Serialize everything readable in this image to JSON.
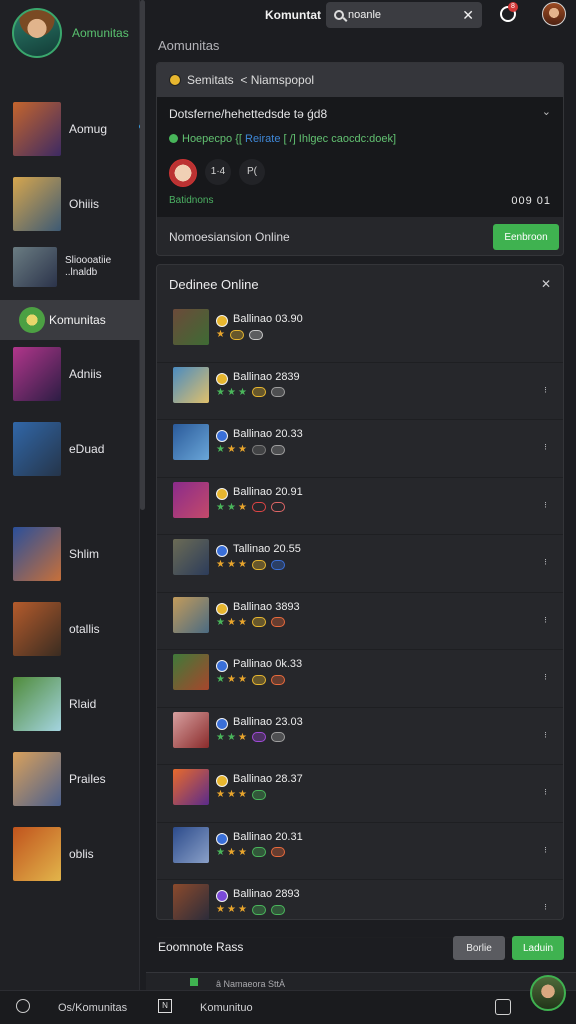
{
  "sidebar": {
    "title": "Aomunitas",
    "items": [
      {
        "label": "Aomug",
        "thumb": [
          "#c4652d",
          "#3d2a63"
        ]
      },
      {
        "label": "Ohiiis",
        "thumb": [
          "#d6a64e",
          "#3d5a74"
        ]
      },
      {
        "label": "Slioooatiie\n..lnaldb",
        "thumb": [
          "#6a7c82",
          "#2b334a"
        ]
      },
      {
        "label": "Komunitas",
        "thumb": [
          "#4ca043",
          "#e9d66b"
        ]
      },
      {
        "label": "Adniis",
        "thumb": [
          "#b1368b",
          "#2c1d44"
        ]
      },
      {
        "label": "eDuad",
        "thumb": [
          "#3167a8",
          "#25354a"
        ]
      },
      {
        "label": "Shlim",
        "thumb": [
          "#2a4f9a",
          "#c7703a"
        ]
      },
      {
        "label": "otallis",
        "thumb": [
          "#b45b2c",
          "#3a2c21"
        ]
      },
      {
        "label": "Rlaid",
        "thumb": [
          "#4f8b3a",
          "#a4d4e0"
        ]
      },
      {
        "label": "Prailes",
        "thumb": [
          "#d9a15c",
          "#4b5f8c"
        ]
      },
      {
        "label": "oblis",
        "thumb": [
          "#c0531d",
          "#e2b54b"
        ]
      }
    ]
  },
  "topbar": {
    "title": "Komuntat",
    "search_value": "noanle",
    "notification_count": "8"
  },
  "main": {
    "section_title": "Aomunitas",
    "post": {
      "header": "Semitats  < Niamspopol",
      "title": "Dotsferne/hehettedsde tǝ ǵd8",
      "sub_text": "Hoepecpo {[",
      "sub_link": "Reirate",
      "sub_after": "[ /] Ihlgec caocdc:doek]",
      "react_btn1": "1·4",
      "react_btn2": "P(",
      "foot_left": "Batidnons",
      "foot_right": "009 01",
      "status_text": "Nomoesiansion Online",
      "join_label": "Eenbroon"
    },
    "online": {
      "title": "Dedinee Online",
      "members": [
        {
          "name": "Ballinao 03.90",
          "avatar": [
            "#6b4a3a",
            "#3e6b34"
          ],
          "dot": "#e7b62f",
          "stars": [
            "#e8a52c"
          ],
          "tags": [
            "#e7b62f",
            "#c8c8c8"
          ]
        },
        {
          "name": "Ballinao 2839",
          "avatar": [
            "#4a8bc0",
            "#e0c06b"
          ],
          "dot": "#e7b62f",
          "stars": [
            "#4ab65b",
            "#4ab65b",
            "#4ab65b"
          ],
          "tags": [
            "#e7b62f",
            "#9f9f9f"
          ]
        },
        {
          "name": "Ballinao 20.33",
          "avatar": [
            "#2a5a9a",
            "#6aa6d8"
          ],
          "dot": "#3a6fd8",
          "stars": [
            "#4ab65b",
            "#e8a52c",
            "#e8a52c"
          ],
          "tags": [
            "#7a7a7a",
            "#9f9f9f"
          ]
        },
        {
          "name": "Ballinao 20.91",
          "avatar": [
            "#8a2b8b",
            "#c44a6a"
          ],
          "dot": "#e7b62f",
          "stars": [
            "#4ab65b",
            "#4ab65b",
            "#e8a52c"
          ],
          "tags": [
            "#d44",
            "#d66"
          ]
        },
        {
          "name": "Tallinao 20.55",
          "avatar": [
            "#6b6b55",
            "#2c3c5a"
          ],
          "dot": "#3a6fd8",
          "stars": [
            "#e8a52c",
            "#e8a52c",
            "#e8a52c"
          ],
          "tags": [
            "#e7b62f",
            "#3a6fd8"
          ]
        },
        {
          "name": "Ballinao 3893",
          "avatar": [
            "#c29b5b",
            "#4b6b82"
          ],
          "dot": "#e7b62f",
          "stars": [
            "#4ab65b",
            "#e8a52c",
            "#e8a52c"
          ],
          "tags": [
            "#e7b62f",
            "#e86a3c"
          ]
        },
        {
          "name": "Pallinao 0k.33",
          "avatar": [
            "#3f7a3a",
            "#a7462c"
          ],
          "dot": "#3a6fd8",
          "stars": [
            "#4ab65b",
            "#e8a52c",
            "#e8a52c"
          ],
          "tags": [
            "#e7b62f",
            "#e86a3c"
          ]
        },
        {
          "name": "Ballinao 23.03",
          "avatar": [
            "#d7a0a0",
            "#8a2b2b"
          ],
          "dot": "#3a6fd8",
          "stars": [
            "#4ab65b",
            "#4ab65b",
            "#e8a52c"
          ],
          "tags": [
            "#a04ad8",
            "#9f9f9f"
          ]
        },
        {
          "name": "Ballinao 28.37",
          "avatar": [
            "#e86a2c",
            "#5a2b8b"
          ],
          "dot": "#e7b62f",
          "stars": [
            "#e8a52c",
            "#e8a52c",
            "#e8a52c"
          ],
          "tags": [
            "#4ab65b"
          ]
        },
        {
          "name": "Ballinao 20.31",
          "avatar": [
            "#2c4b8b",
            "#8aa0c8"
          ],
          "dot": "#3a6fd8",
          "stars": [
            "#4ab65b",
            "#e8a52c",
            "#e8a52c"
          ],
          "tags": [
            "#4ab65b",
            "#e86a3c"
          ]
        },
        {
          "name": "Ballinao 2893",
          "avatar": [
            "#8b4a2c",
            "#2c2c3a"
          ],
          "dot": "#7a4ad8",
          "stars": [
            "#e8a52c",
            "#e8a52c",
            "#e8a52c"
          ],
          "tags": [
            "#4ab65b",
            "#4ab65b"
          ]
        }
      ]
    },
    "bottom": {
      "title": "Eoomnote Rass",
      "btn_gray": "Borlie",
      "btn_green": "Laduin",
      "peek_text": "â Namaeora SttÀ"
    }
  },
  "nav": {
    "label1": "Os/Komunitas",
    "label2": "Komunituo",
    "box": "N"
  },
  "colors": {
    "accent_green": "#3fb250",
    "link_blue": "#3f88d8",
    "background": "#1c1d21"
  }
}
